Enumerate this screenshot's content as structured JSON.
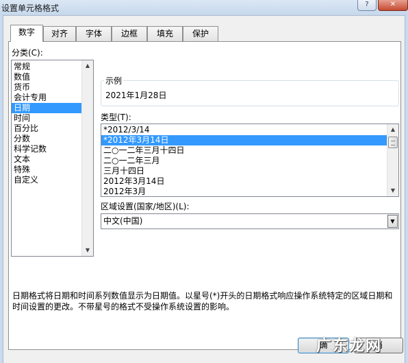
{
  "window": {
    "title": "设置单元格格式",
    "help_glyph": "?",
    "close_glyph": "✕"
  },
  "tabs": [
    {
      "label": "数字",
      "active": true
    },
    {
      "label": "对齐"
    },
    {
      "label": "字体"
    },
    {
      "label": "边框"
    },
    {
      "label": "填充"
    },
    {
      "label": "保护"
    }
  ],
  "category": {
    "label": "分类(C):",
    "items": [
      "常规",
      "数值",
      "货币",
      "会计专用",
      "日期",
      "时间",
      "百分比",
      "分数",
      "科学记数",
      "文本",
      "特殊",
      "自定义"
    ],
    "selected": "日期"
  },
  "sample": {
    "legend": "示例",
    "value": "2021年1月28日"
  },
  "type": {
    "label": "类型(T):",
    "items": [
      "*2012/3/14",
      "*2012年3月14日",
      "二○一二年三月十四日",
      "二○一二年三月",
      "三月十四日",
      "2012年3月14日",
      "2012年3月"
    ],
    "selected": "*2012年3月14日"
  },
  "locale": {
    "label": "区域设置(国家/地区)(L):",
    "value": "中文(中国)"
  },
  "description": "日期格式将日期和时间系列数值显示为日期值。以星号(*)开头的日期格式响应操作系统特定的区域日期和时间设置的更改。不带星号的格式不受操作系统设置的影响。",
  "buttons": {
    "ok_fragment": "确",
    "cancel_fragment": "消"
  },
  "watermark": "广东龙网",
  "glyphs": {
    "up": "▲",
    "down": "▼"
  },
  "colors": {
    "selection": "#3399ff",
    "titlebar": "#c9dbee"
  }
}
